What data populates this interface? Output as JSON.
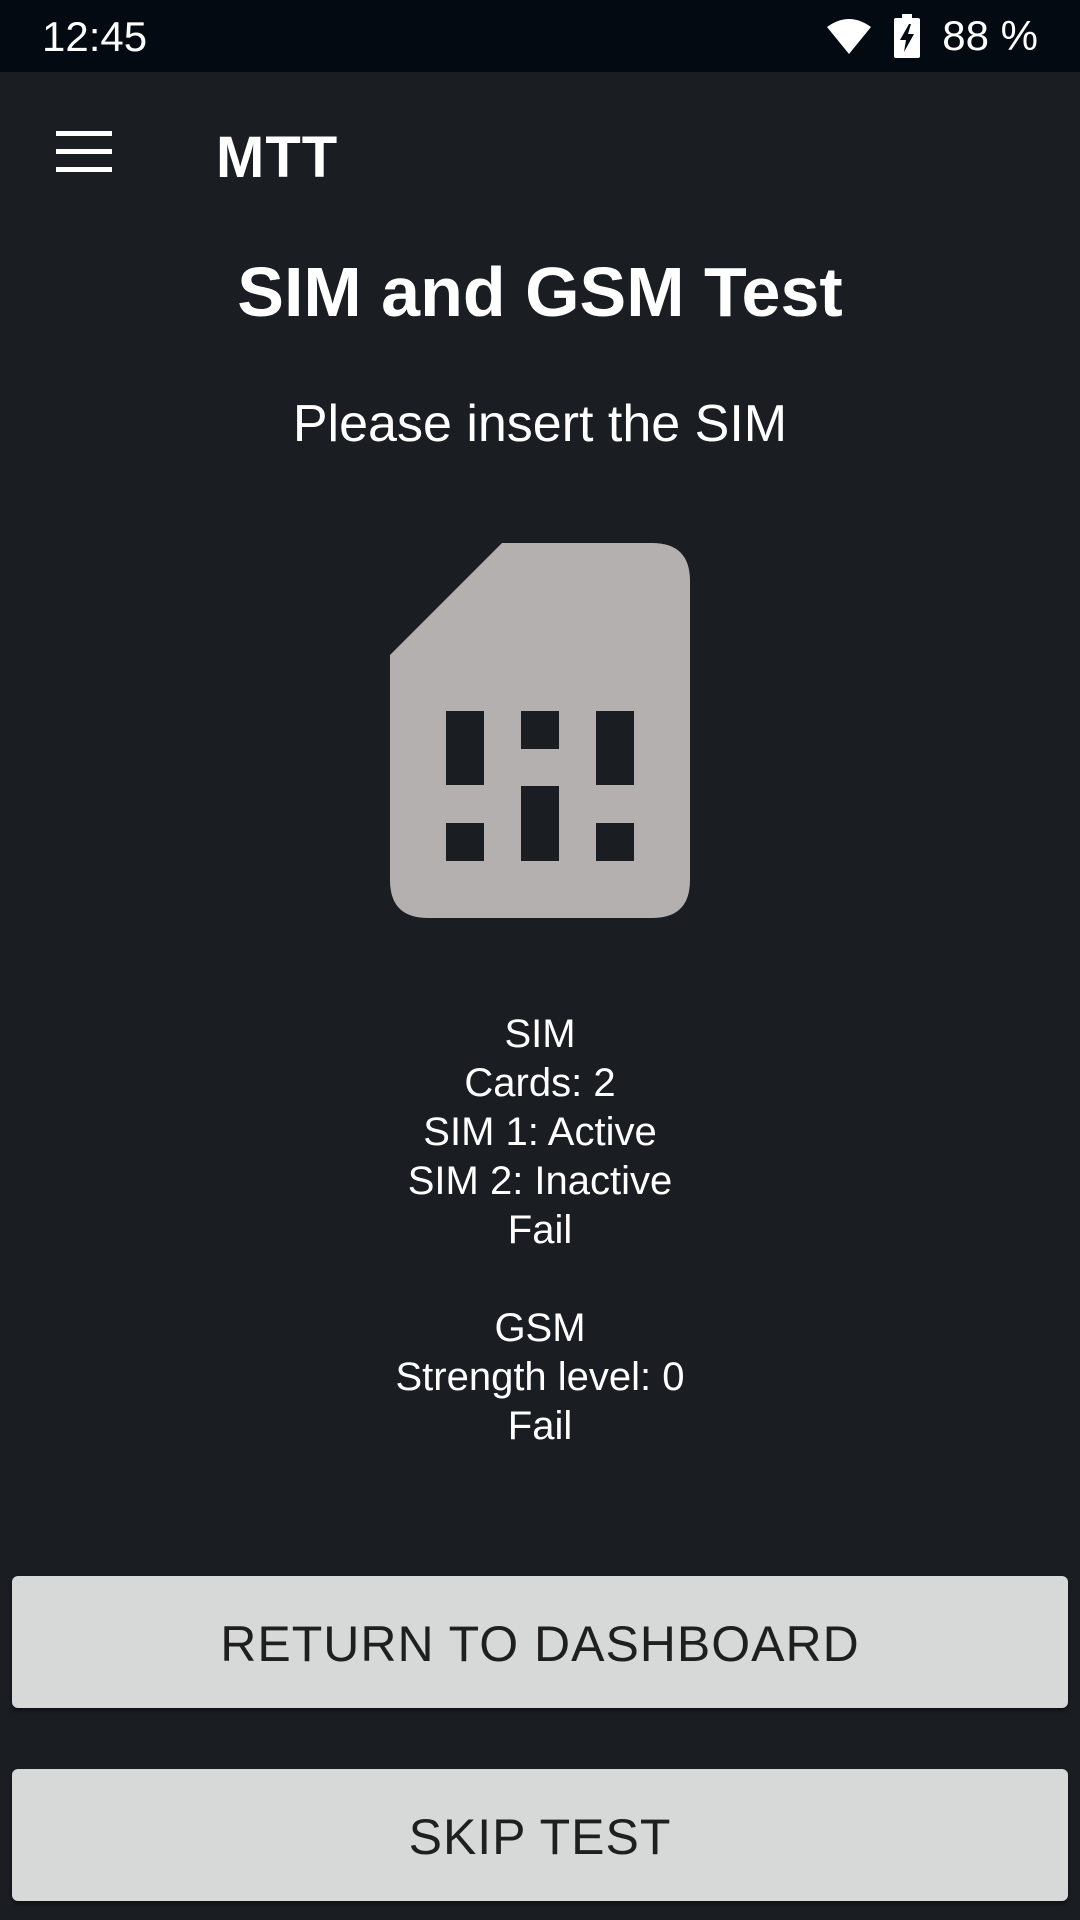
{
  "status_bar": {
    "time": "12:45",
    "battery_percent": "88 %",
    "icons": [
      "wifi-icon",
      "battery-charging-icon"
    ]
  },
  "app_bar": {
    "title": "MTT",
    "menu_icon": "hamburger-menu-icon"
  },
  "main": {
    "title": "SIM and GSM Test",
    "instruction": "Please insert the SIM",
    "illustration_icon": "sim-card-icon",
    "sim": {
      "heading": "SIM",
      "cards": "Cards: 2",
      "sim1": "SIM 1: Active",
      "sim2": "SIM 2: Inactive",
      "result": "Fail"
    },
    "gsm": {
      "heading": "GSM",
      "strength": "Strength level: 0",
      "result": "Fail"
    }
  },
  "buttons": {
    "return_label": "RETURN TO DASHBOARD",
    "skip_label": "SKIP TEST"
  },
  "colors": {
    "background": "#1a1e23",
    "status_bar": "#030a11",
    "sim_icon": "#b5b0b0",
    "button_bg": "#d7d8d8",
    "button_text": "#1f1f1f"
  }
}
